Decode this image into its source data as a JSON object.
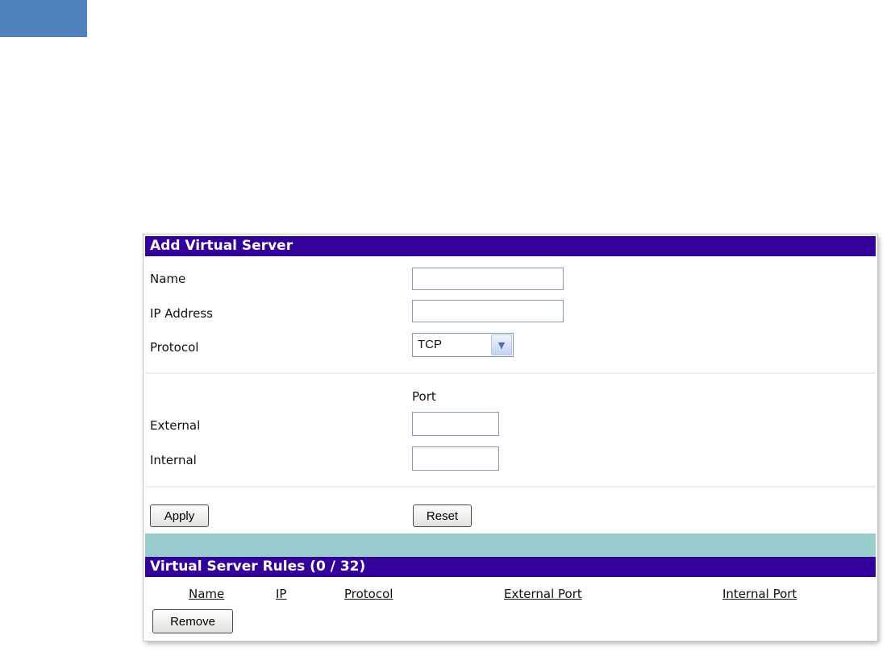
{
  "add_section": {
    "title": "Add Virtual Server",
    "fields": {
      "name": {
        "label": "Name",
        "value": ""
      },
      "ip_address": {
        "label": "IP Address",
        "value": ""
      },
      "protocol": {
        "label": "Protocol",
        "selected": "TCP"
      }
    },
    "port_heading": "Port",
    "external": {
      "label": "External",
      "value": ""
    },
    "internal": {
      "label": "Internal",
      "value": ""
    },
    "apply_label": "Apply",
    "reset_label": "Reset"
  },
  "rules_section": {
    "title": "Virtual Server Rules (0 / 32)",
    "columns": [
      "Name",
      "IP",
      "Protocol",
      "External Port",
      "Internal Port"
    ],
    "remove_label": "Remove"
  },
  "colors": {
    "header_bg": "#330099",
    "band_bg": "#99cccc",
    "corner_tab": "#4f81bd"
  }
}
